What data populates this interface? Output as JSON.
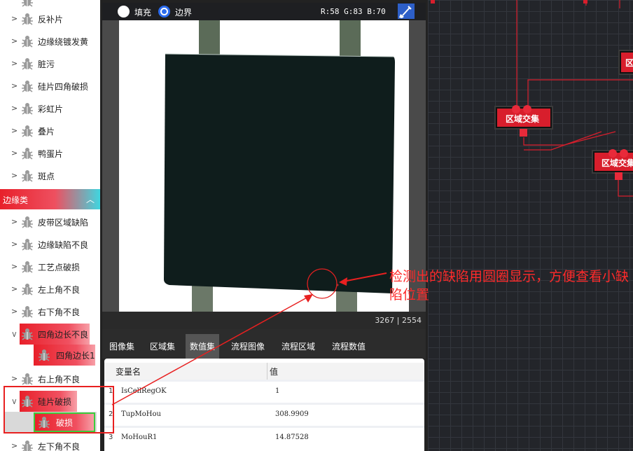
{
  "tree": {
    "items_top": [
      {
        "label": "反补片"
      },
      {
        "label": "边缘绕镀发黄"
      },
      {
        "label": "脏污"
      },
      {
        "label": "硅片四角破损"
      },
      {
        "label": "彩虹片"
      },
      {
        "label": "叠片"
      },
      {
        "label": "鸭蛋片"
      },
      {
        "label": "斑点"
      }
    ],
    "category_edge": {
      "label": "边缘类"
    },
    "items_edge": [
      {
        "label": "皮带区域缺陷"
      },
      {
        "label": "边缘缺陷不良"
      },
      {
        "label": "工艺点破损"
      },
      {
        "label": "左上角不良"
      },
      {
        "label": "右下角不良"
      },
      {
        "label": "四角边长不良"
      },
      {
        "label": "四角边长1"
      },
      {
        "label": "右上角不良"
      },
      {
        "label": "硅片破损"
      },
      {
        "label": "破损"
      },
      {
        "label": "左下角不良"
      }
    ]
  },
  "topbar": {
    "fill_label": "填充",
    "border_label": "边界",
    "selected": "边界",
    "rgb": "R:58  G:83  B:70"
  },
  "status": {
    "size": "3267 | 2554"
  },
  "tabs": [
    {
      "label": "图像集",
      "active": false
    },
    {
      "label": "区域集",
      "active": false
    },
    {
      "label": "数值集",
      "active": true
    },
    {
      "label": "流程图像",
      "active": false
    },
    {
      "label": "流程区域",
      "active": false
    },
    {
      "label": "流程数值",
      "active": false
    }
  ],
  "table": {
    "headers": [
      "变量名",
      "值"
    ],
    "rows": [
      {
        "idx": "1",
        "name": "IsCellRegOK",
        "value": "1"
      },
      {
        "idx": "2",
        "name": "TupMoHou",
        "value": "308.9909"
      },
      {
        "idx": "3",
        "name": "MoHouR1",
        "value": "14.87528"
      }
    ]
  },
  "flow": {
    "nodes": [
      {
        "label": "区域交集"
      },
      {
        "label": "区域交集"
      },
      {
        "label": "区"
      }
    ]
  },
  "annotation": {
    "text": "检测出的缺陷用圆圈显示，方便查看小缺陷位置"
  },
  "colors": {
    "accent_red": "#e8202a",
    "annotation_red": "#ff2a2a",
    "accent_cyan": "#3fd6e0",
    "node_red": "#d81e2c"
  }
}
